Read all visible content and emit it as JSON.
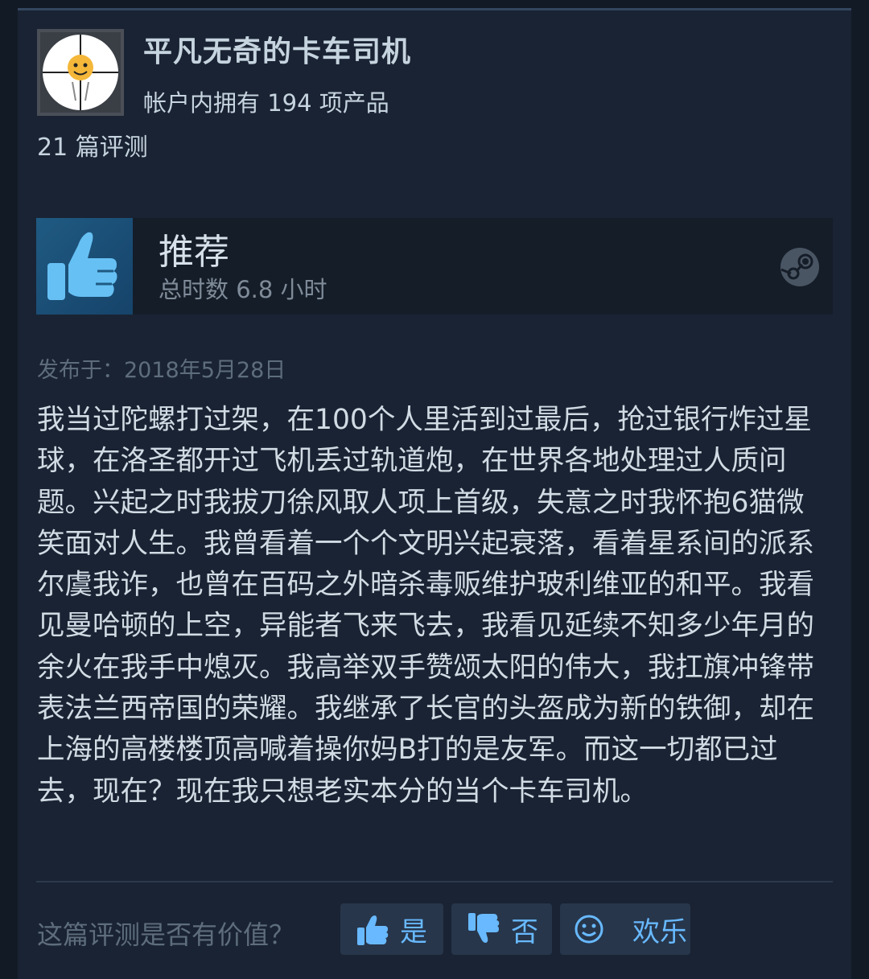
{
  "author": {
    "name": "平凡无奇的卡车司机",
    "products_owned": "帐户内拥有 194 项产品",
    "reviews_count": "21 篇评测"
  },
  "recommendation": {
    "label": "推荐",
    "hours": "总时数 6.8 小时",
    "thumb_icon": "thumbs-up-icon",
    "platform_icon": "steam-logo-icon"
  },
  "review": {
    "posted": "发布于：2018年5月28日",
    "body": "我当过陀螺打过架，在100个人里活到过最后，抢过银行炸过星球，在洛圣都开过飞机丢过轨道炮，在世界各地处理过人质问题。兴起之时我拔刀徐风取人项上首级，失意之时我怀抱6猫微笑面对人生。我曾看着一个个文明兴起衰落，看着星系间的派系尔虞我诈，也曾在百码之外暗杀毒贩维护玻利维亚的和平。我看见曼哈顿的上空，异能者飞来飞去，我看见延续不知多少年月的余火在我手中熄灭。我高举双手赞颂太阳的伟大，我扛旗冲锋带表法兰西帝国的荣耀。我继承了长官的头盔成为新的铁御，却在上海的高楼楼顶高喊着操你妈B打的是友军。而这一切都已过去，现在？现在我只想老实本分的当个卡车司机。"
  },
  "helpful": {
    "question": "这篇评测是否有价值？",
    "yes_label": "是",
    "no_label": "否",
    "funny_label": "欢乐"
  },
  "colors": {
    "background": "#121a26",
    "card": "#1a2333",
    "text": "#c6d4df",
    "muted": "#5e6d7c",
    "accent": "#68b9ff"
  }
}
